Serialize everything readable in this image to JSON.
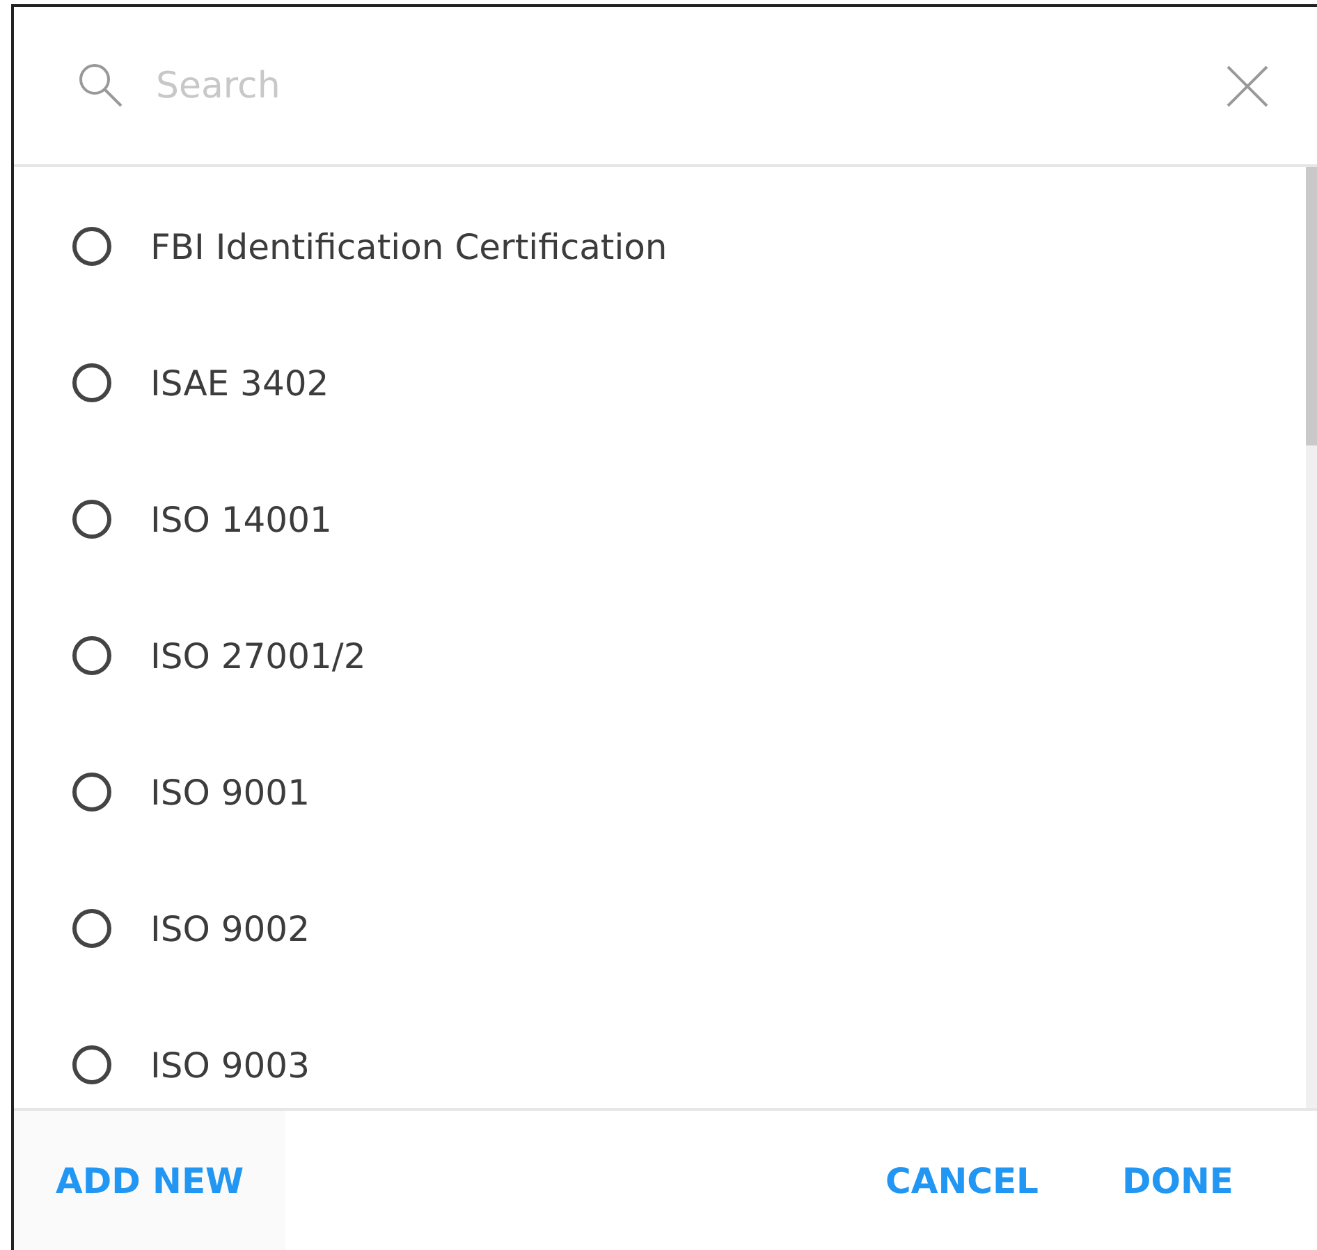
{
  "search": {
    "placeholder": "Search"
  },
  "options": [
    {
      "label": "FBI Identification Certification",
      "selected": false
    },
    {
      "label": "ISAE 3402",
      "selected": false
    },
    {
      "label": "ISO 14001",
      "selected": false
    },
    {
      "label": "ISO 27001/2",
      "selected": false
    },
    {
      "label": "ISO 9001",
      "selected": false
    },
    {
      "label": "ISO 9002",
      "selected": false
    },
    {
      "label": "ISO 9003",
      "selected": false
    }
  ],
  "footer": {
    "add_button": "ADD NEW",
    "cancel_button": "CANCEL",
    "done_button": "DONE"
  }
}
